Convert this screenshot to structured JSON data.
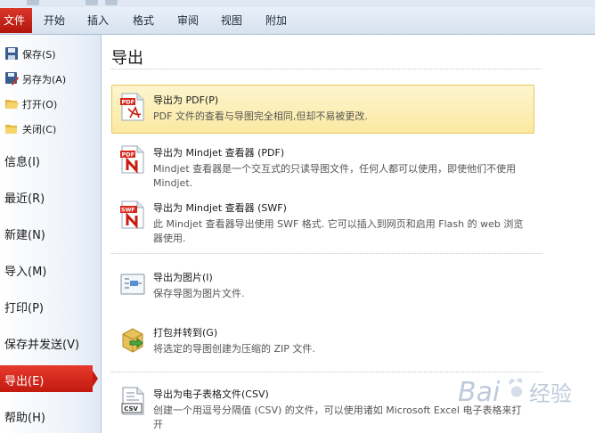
{
  "ribbon": {
    "file_tab": "文件",
    "tabs": [
      "开始",
      "插入",
      "格式",
      "审阅",
      "视图",
      "附加"
    ]
  },
  "nav": {
    "small_items": [
      {
        "label": "保存(S)",
        "icon": "save-icon"
      },
      {
        "label": "另存为(A)",
        "icon": "save-as-icon"
      },
      {
        "label": "打开(O)",
        "icon": "open-folder-icon"
      },
      {
        "label": "关闭(C)",
        "icon": "close-folder-icon"
      }
    ],
    "items": [
      "信息(I)",
      "最近(R)",
      "新建(N)",
      "导入(M)",
      "打印(P)",
      "保存并发送(V)",
      "导出(E)",
      "帮助(H)"
    ],
    "selected": "导出(E)"
  },
  "main": {
    "title": "导出",
    "items": [
      {
        "title": "导出为 PDF(P)",
        "desc": "PDF 文件的查看与导图完全相同,但却不易被更改.",
        "icon": "pdf-adobe-icon",
        "highlighted": true
      },
      {
        "title": "导出为 Mindjet 查看器 (PDF)",
        "desc": "Mindjet 查看器是一个交互式的只读导图文件，任何人都可以使用，即使他们不使用 Mindjet.",
        "icon": "pdf-mindjet-icon"
      },
      {
        "title": "导出为 Mindjet 查看器 (SWF)",
        "desc": "此 Mindjet 查看器导出使用 SWF 格式. 它可以插入到网页和启用 Flash 的 web 浏览器使用.",
        "icon": "swf-mindjet-icon"
      },
      {
        "title": "导出为图片(I)",
        "desc": "保存导图为图片文件.",
        "icon": "image-export-icon"
      },
      {
        "title": "打包并转到(G)",
        "desc": "将选定的导图创建为压缩的 ZIP 文件.",
        "icon": "package-zip-icon"
      },
      {
        "title": "导出为电子表格文件(CSV)",
        "desc": "创建一个用逗号分隔值 (CSV) 的文件，可以使用诸如 Microsoft Excel 电子表格来打开",
        "icon": "csv-file-icon"
      }
    ]
  },
  "watermark": {
    "brand": "Bai",
    "suffix": "经验"
  },
  "colors": {
    "accent_red": "#c21a10",
    "highlight": "#fbe9a1",
    "ribbon_bg": "#dfe8f3"
  }
}
